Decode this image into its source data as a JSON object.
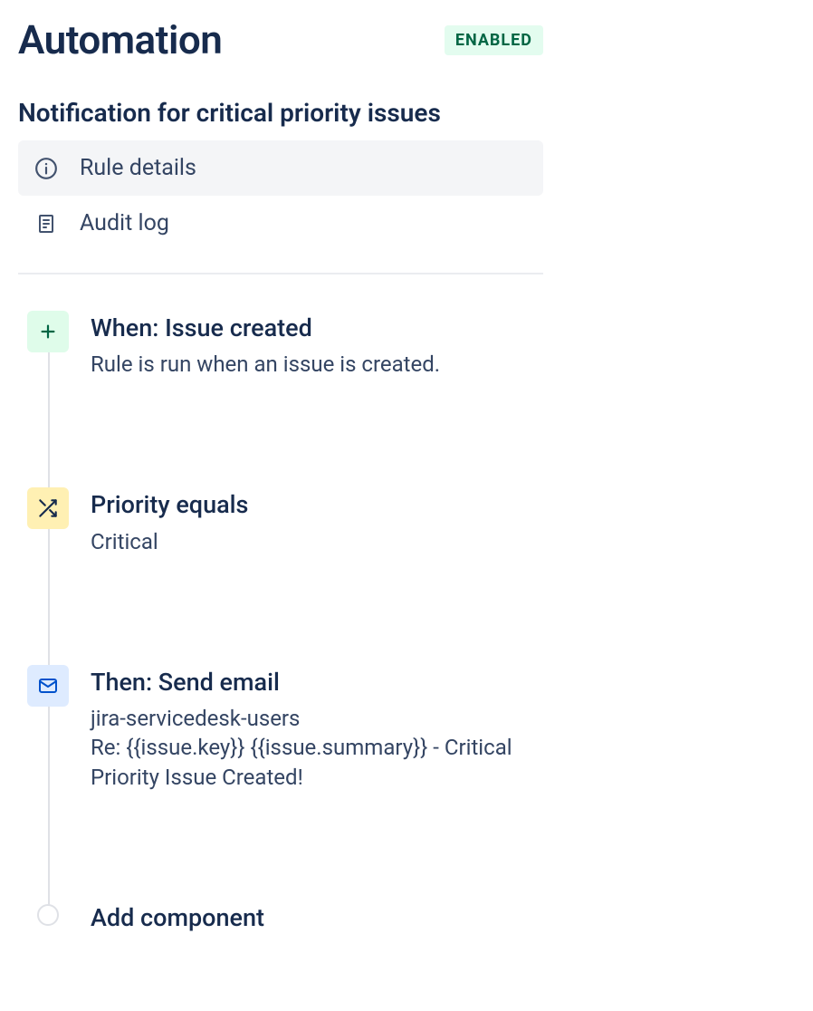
{
  "header": {
    "title": "Automation",
    "status_badge": "ENABLED"
  },
  "rule": {
    "title": "Notification for critical priority issues",
    "tabs": {
      "details_label": "Rule details",
      "audit_label": "Audit log"
    }
  },
  "flow": {
    "steps": [
      {
        "icon": "plus-icon",
        "title": "When: Issue created",
        "desc": "Rule is run when an issue is created."
      },
      {
        "icon": "shuffle-icon",
        "title": "Priority equals",
        "desc": "Critical"
      },
      {
        "icon": "mail-icon",
        "title": "Then: Send email",
        "desc": "jira-servicedesk-users\nRe: {{issue.key}} {{issue.summary}} - Critical Priority Issue Created!"
      }
    ],
    "add_label": "Add component"
  }
}
